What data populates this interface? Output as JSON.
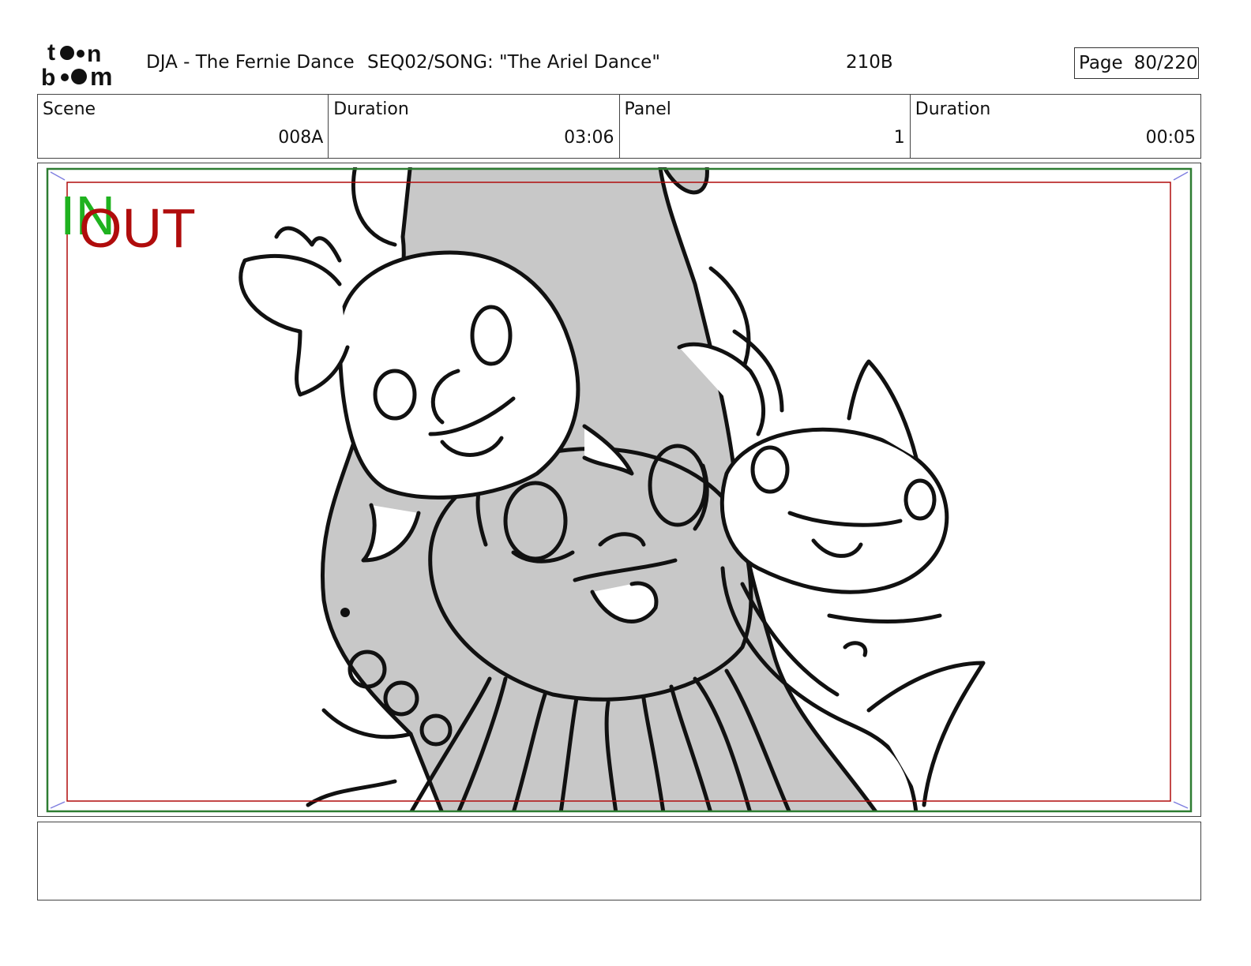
{
  "header": {
    "logo_text": "toon boom",
    "project": "DJA - The Fernie Dance",
    "sequence": "SEQ02/SONG: \"The Ariel Dance\"",
    "page_code": "210B",
    "page_label": "Page",
    "page_number": "80/220"
  },
  "info": {
    "scene_label": "Scene",
    "scene_value": "008A",
    "scene_duration_label": "Duration",
    "scene_duration_value": "03:06",
    "panel_label": "Panel",
    "panel_value": "1",
    "panel_duration_label": "Duration",
    "panel_duration_value": "00:05"
  },
  "panel": {
    "in_label": "IN",
    "out_label": "OUT",
    "in_frame_color": "#2e7d32",
    "out_frame_color": "#b00c0c",
    "fill_color": "#c8c8c8",
    "line_color": "#111111"
  },
  "notes": {
    "text": ""
  }
}
